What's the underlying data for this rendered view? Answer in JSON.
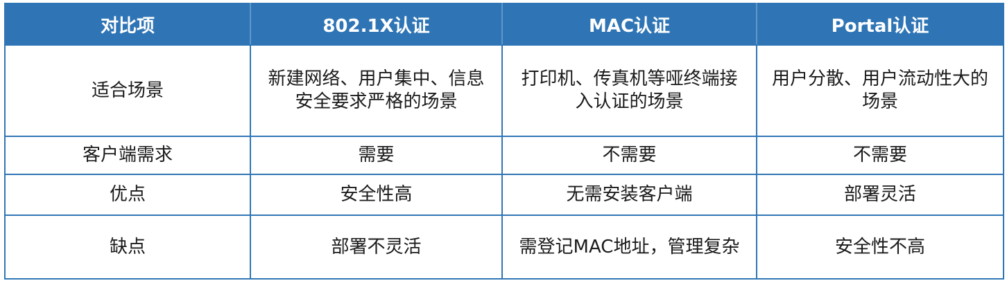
{
  "table": {
    "headers": [
      "对比项",
      "802.1X认证",
      "MAC认证",
      "Portal认证"
    ],
    "rows": [
      [
        "适合场景",
        "新建网络、用户集中、信息安全要求严格的场景",
        "打印机、传真机等哑终端接入认证的场景",
        "用户分散、用户流动性大的场景"
      ],
      [
        "客户端需求",
        "需要",
        "不需要",
        "不需要"
      ],
      [
        "优点",
        "安全性高",
        "无需安装客户端",
        "部署灵活"
      ],
      [
        "缺点",
        "部署不灵活",
        "需登记MAC地址，管理复杂",
        "安全性不高"
      ]
    ]
  }
}
